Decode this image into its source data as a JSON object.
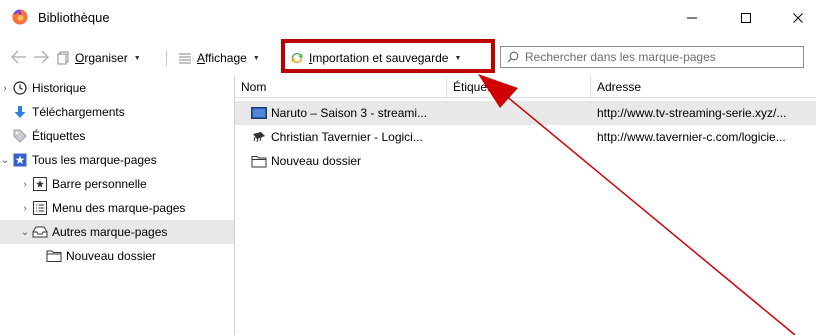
{
  "window": {
    "title": "Bibliothèque",
    "minimize_glyph": "—",
    "maximize_glyph": "☐",
    "close_glyph": "✕"
  },
  "toolbar": {
    "back_icon": "back-arrow-icon",
    "forward_icon": "forward-arrow-icon",
    "organize": {
      "icon": "organize-icon",
      "accel": "O",
      "rest": "rganiser"
    },
    "view": {
      "icon": "view-icon",
      "accel": "A",
      "rest": "ffichage"
    },
    "import": {
      "icon": "import-backup-icon",
      "accel": "I",
      "rest": "mportation et sauvegarde"
    },
    "caret": "▼"
  },
  "search": {
    "placeholder": "Rechercher dans les marque-pages"
  },
  "sidebar": {
    "items": [
      {
        "label": "Historique",
        "icon": "history-clock-icon"
      },
      {
        "label": "Téléchargements",
        "icon": "download-arrow-icon"
      },
      {
        "label": "Étiquettes",
        "icon": "tag-icon"
      },
      {
        "label": "Tous les marque-pages",
        "icon": "bookmarks-star-icon"
      },
      {
        "label": "Barre personnelle",
        "icon": "bookmarks-toolbar-icon"
      },
      {
        "label": "Menu des marque-pages",
        "icon": "bookmarks-menu-icon"
      },
      {
        "label": "Autres marque-pages",
        "icon": "other-bookmarks-icon"
      },
      {
        "label": "Nouveau dossier",
        "icon": "folder-icon"
      }
    ]
  },
  "table": {
    "headers": [
      "Nom",
      "Étiquettes",
      "Adresse"
    ],
    "rows": [
      {
        "name": "Naruto – Saison 3 - streami...",
        "tags": "",
        "address": "http://www.tv-streaming-serie.xyz/...",
        "icon": "site-favicon-icon"
      },
      {
        "name": "Christian Tavernier - Logici...",
        "tags": "",
        "address": "http://www.tavernier-c.com/logicie...",
        "icon": "chip-favicon-icon"
      },
      {
        "name": "Nouveau dossier",
        "tags": "",
        "address": "",
        "icon": "folder-icon"
      }
    ]
  },
  "colors": {
    "highlight": "#c00000",
    "arrow": "#d00000",
    "selection": "#e8e8e8",
    "firefox_orange": "#ff7139",
    "firefox_purple": "#7542e5"
  }
}
